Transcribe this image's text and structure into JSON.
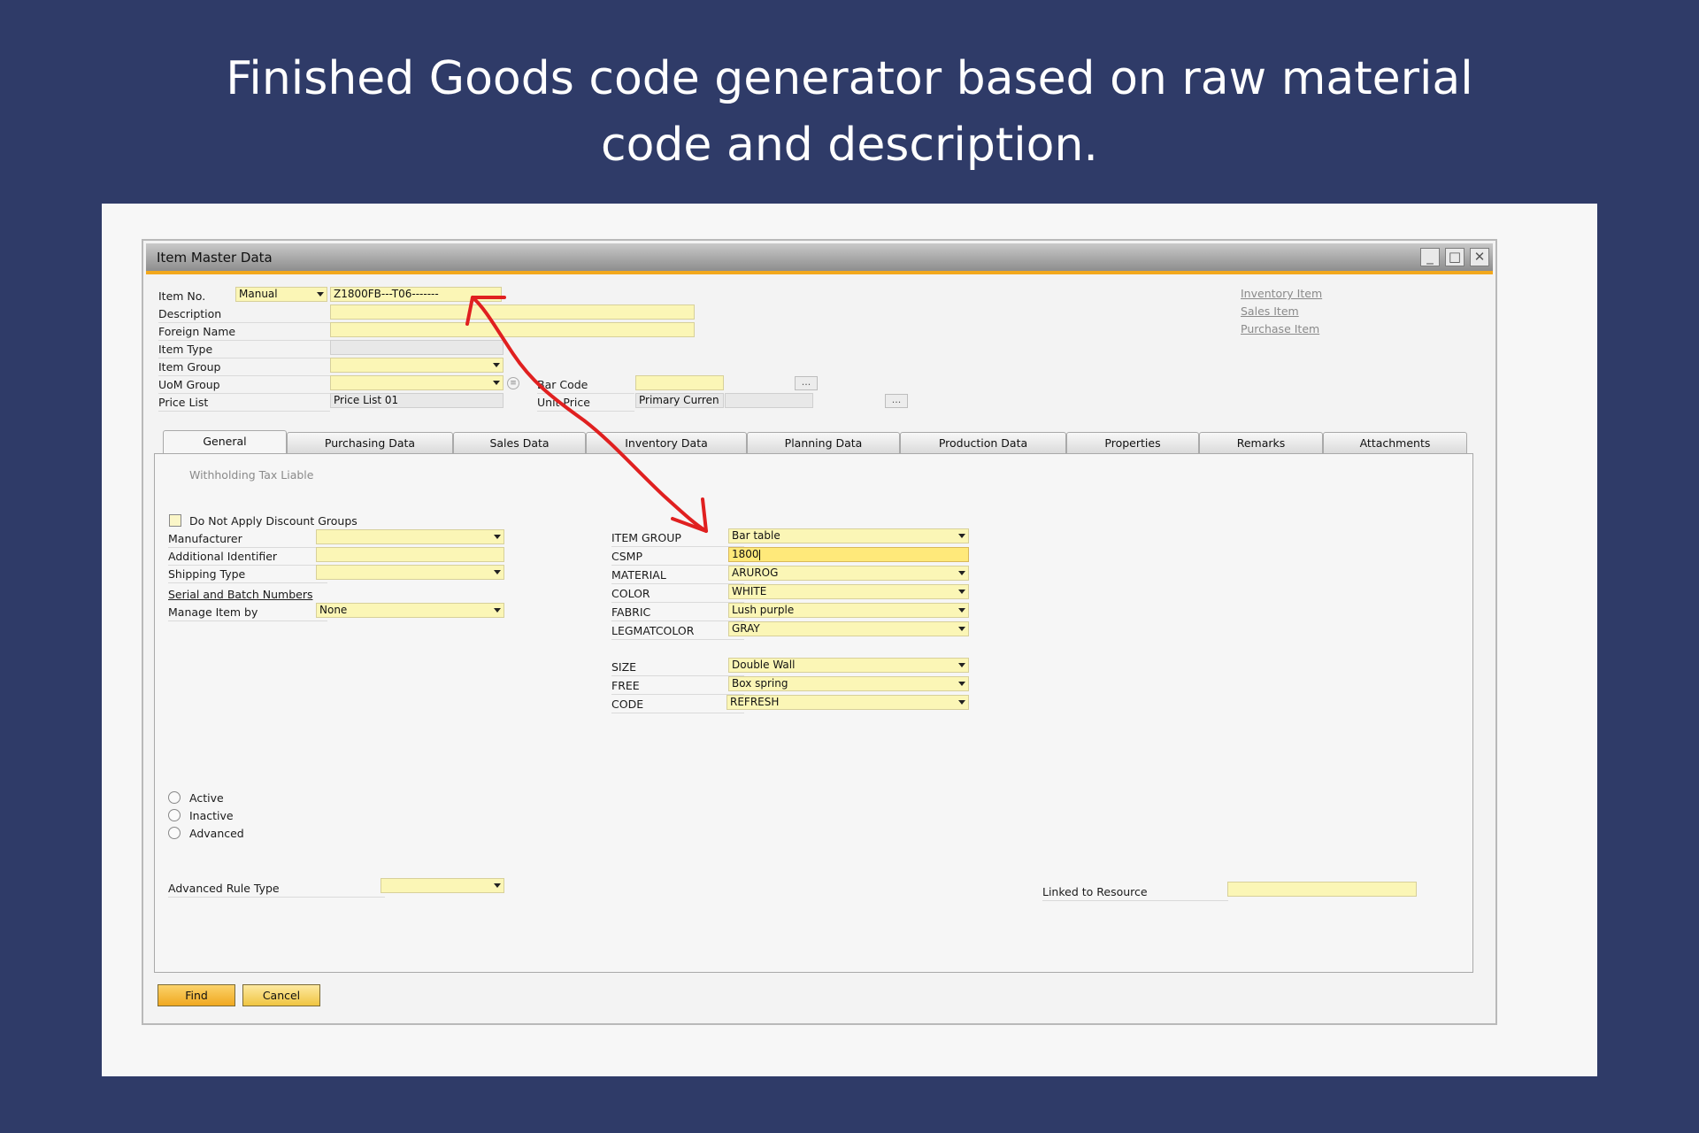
{
  "headline": {
    "line1": "Finished Goods code generator based on raw material",
    "line2": "code and description."
  },
  "window": {
    "title": "Item Master Data"
  },
  "header": {
    "item_no_label": "Item No.",
    "item_no_series": "Manual",
    "item_no_value": "Z1800FB---T06-------",
    "description_label": "Description",
    "foreign_name_label": "Foreign Name",
    "item_type_label": "Item Type",
    "item_group_label": "Item Group",
    "uom_group_label": "UoM Group",
    "price_list_label": "Price List",
    "price_list_value": "Price List 01",
    "bar_code_label": "Bar Code",
    "unit_price_label": "Unit Price",
    "unit_price_currency": "Primary Curren",
    "ellipsis": "...",
    "inventory_item": "Inventory Item",
    "sales_item": "Sales Item",
    "purchase_item": "Purchase Item"
  },
  "tabs": [
    "General",
    "Purchasing Data",
    "Sales Data",
    "Inventory Data",
    "Planning Data",
    "Production Data",
    "Properties",
    "Remarks",
    "Attachments"
  ],
  "general": {
    "withholding_tax": "Withholding Tax Liable",
    "no_discount": "Do Not Apply Discount Groups",
    "manufacturer_label": "Manufacturer",
    "additional_identifier_label": "Additional Identifier",
    "shipping_type_label": "Shipping Type",
    "serial_batch_label": "Serial and Batch Numbers",
    "manage_item_by_label": "Manage Item by",
    "manage_item_by_value": "None",
    "active": "Active",
    "inactive": "Inactive",
    "advanced": "Advanced",
    "advanced_rule_type_label": "Advanced Rule Type",
    "linked_resource_label": "Linked to Resource"
  },
  "code_fields": [
    {
      "label": "ITEM GROUP",
      "value": "Bar table"
    },
    {
      "label": "CSMP",
      "value": "1800"
    },
    {
      "label": "MATERIAL",
      "value": "ARUROG"
    },
    {
      "label": "COLOR",
      "value": "WHITE"
    },
    {
      "label": "FABRIC",
      "value": "Lush purple"
    },
    {
      "label": "LEGMATCOLOR",
      "value": "GRAY"
    },
    {
      "label": "SIZE",
      "value": "Double Wall"
    },
    {
      "label": "FREE",
      "value": "Box spring"
    },
    {
      "label": "CODE",
      "value": "REFRESH"
    }
  ],
  "buttons": {
    "find": "Find",
    "cancel": "Cancel"
  },
  "colors": {
    "background": "#2f3b68",
    "field": "#fbf6b6",
    "accent": "#f2a81d",
    "arrow": "#e02020"
  }
}
